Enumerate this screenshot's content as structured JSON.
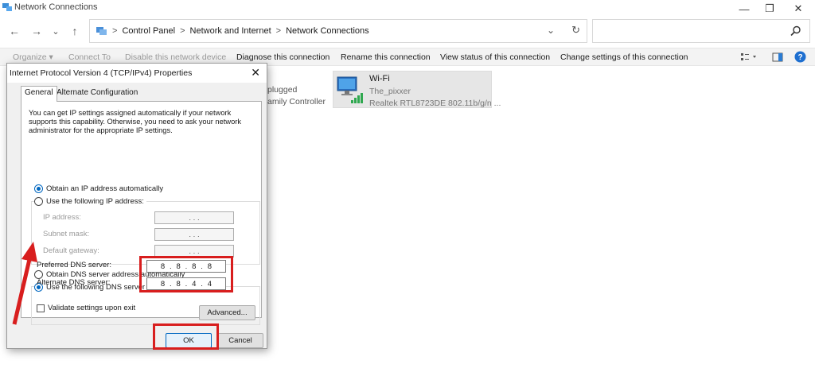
{
  "window": {
    "title": "Network Connections",
    "minimize": "—",
    "maximize": "❐",
    "close": "✕"
  },
  "nav": {
    "back": "←",
    "forward": "→",
    "recent": "⌄",
    "up": "↑"
  },
  "address": {
    "crumbs": [
      "Control Panel",
      "Network and Internet",
      "Network Connections"
    ],
    "separator": ">",
    "dropdown": "⌄",
    "refresh": "↻"
  },
  "search": {
    "placeholder": ""
  },
  "commands": {
    "organize": "Organize ▾",
    "connect_to": "Connect To",
    "disable": "Disable this network device",
    "diagnose": "Diagnose this connection",
    "rename": "Rename this connection",
    "view_status": "View status of this connection",
    "change_settings": "Change settings of this connection"
  },
  "background_items": {
    "partial_1": "plugged",
    "partial_2": "amily Controller",
    "wifi": {
      "name": "Wi-Fi",
      "ssid": "The_pixxer",
      "adapter": "Realtek RTL8723DE 802.11b/g/n ..."
    }
  },
  "dialog": {
    "title": "Internet Protocol Version 4 (TCP/IPv4) Properties",
    "close": "✕",
    "tabs": [
      "General",
      "Alternate Configuration"
    ],
    "description": "You can get IP settings assigned automatically if your network supports this capability. Otherwise, you need to ask your network administrator for the appropriate IP settings.",
    "ip_auto": "Obtain an IP address automatically",
    "ip_manual": "Use the following IP address:",
    "ip_address_label": "IP address:",
    "subnet_label": "Subnet mask:",
    "gateway_label": "Default gateway:",
    "empty_ip": ".   .   .",
    "dns_auto": "Obtain DNS server address automatically",
    "dns_manual": "Use the following DNS server addresses:",
    "preferred_label": "Preferred DNS server:",
    "alternate_label": "Alternate DNS server:",
    "preferred_dns": [
      "8",
      "8",
      "8",
      "8"
    ],
    "alternate_dns": [
      "8",
      "8",
      "4",
      "4"
    ],
    "validate": "Validate settings upon exit",
    "advanced": "Advanced...",
    "ok": "OK",
    "cancel": "Cancel"
  },
  "colors": {
    "accent": "#0067c0",
    "annotation": "#d81e1e",
    "wifi_tile": "#e6e6e6"
  }
}
